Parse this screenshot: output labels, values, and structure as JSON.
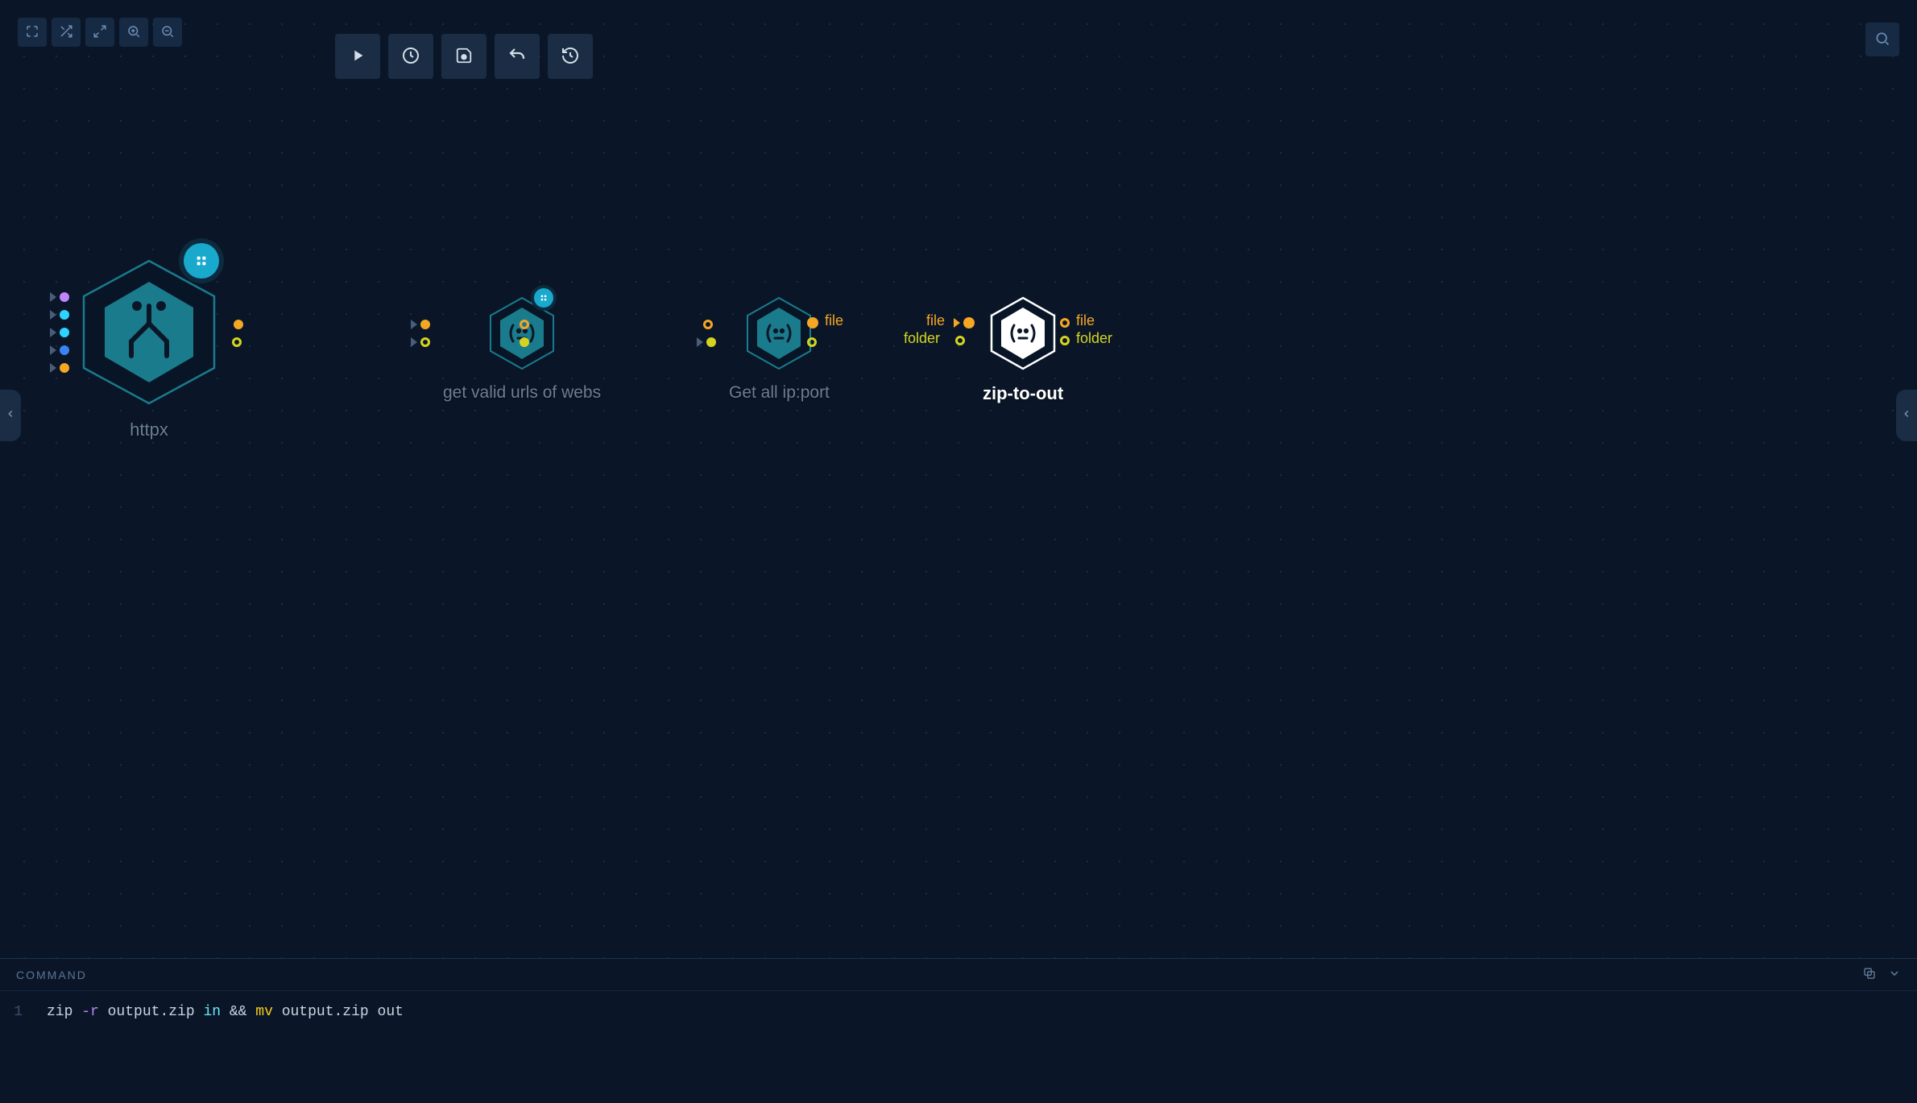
{
  "toolbar": {
    "view": [
      "fit",
      "shuffle",
      "expand",
      "zoom-in",
      "zoom-out"
    ],
    "actions": [
      "play",
      "schedule",
      "save",
      "undo",
      "history"
    ]
  },
  "nodes": {
    "httpx": {
      "label": "httpx",
      "selected": false
    },
    "validurls": {
      "label": "get valid urls of webs",
      "selected": false
    },
    "ipport": {
      "label": "Get all ip:port",
      "selected": false
    },
    "zip": {
      "label": "zip-to-out",
      "selected": true
    }
  },
  "port_labels": {
    "ipport_out_file": "file",
    "zip_in_file": "file",
    "zip_in_folder": "folder",
    "zip_out_file": "file",
    "zip_out_folder": "folder"
  },
  "command_panel": {
    "title": "COMMAND",
    "lineno": "1",
    "code": {
      "t1": "zip ",
      "flag": "-r",
      "t2": " output.zip ",
      "kw1": "in",
      "t3": " && ",
      "cmd2": "mv",
      "t4": " output.zip out"
    }
  },
  "colors": {
    "orange": "#f5a623",
    "yellow": "#d4d420",
    "cyan": "#2dd4ff",
    "blue": "#3b82f6",
    "purple": "#c084fc",
    "teal": "#1a7b8c"
  }
}
